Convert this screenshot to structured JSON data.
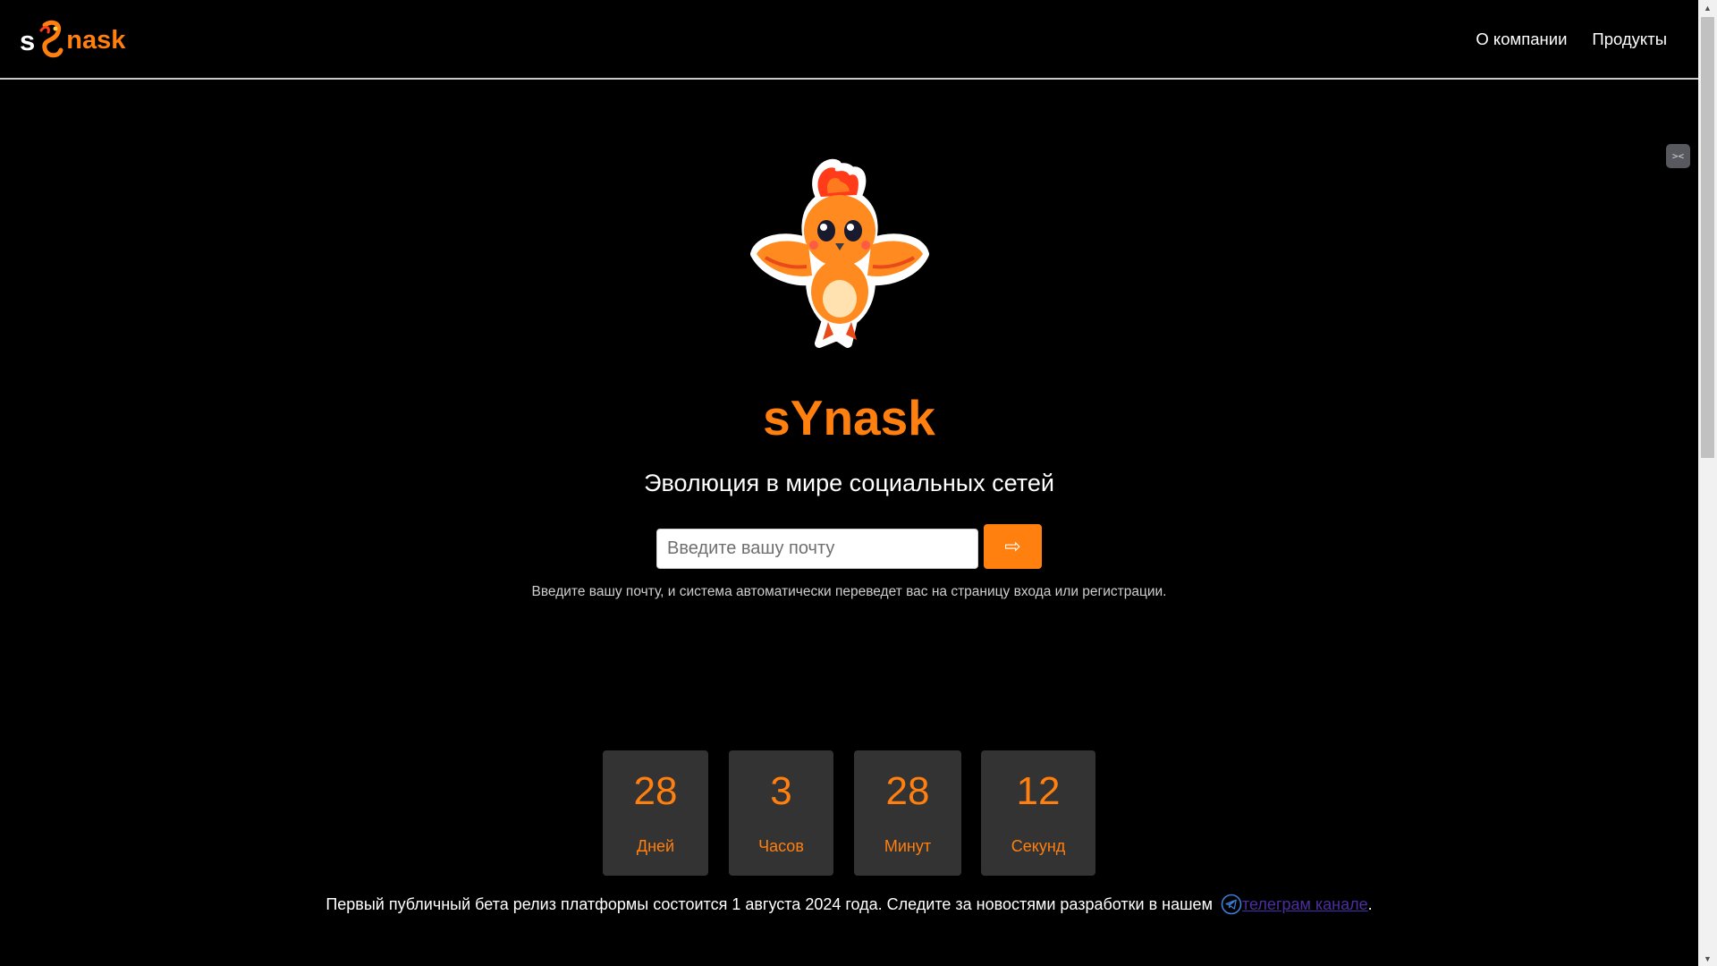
{
  "header": {
    "logo": {
      "prefix": "s",
      "suffix": "nask"
    },
    "nav": [
      {
        "label": "О компании"
      },
      {
        "label": "Продукты"
      }
    ]
  },
  "hero": {
    "title": "sYnask",
    "tagline": "Эволюция в мире социальных сетей",
    "email_placeholder": "Введите вашу почту",
    "submit_icon": "⇨",
    "hint": "Введите вашу почту, и система автоматически переведет вас на страницу входа или регистрации."
  },
  "countdown": [
    {
      "value": "28",
      "label": "Дней"
    },
    {
      "value": "3",
      "label": "Часов"
    },
    {
      "value": "28",
      "label": "Минут"
    },
    {
      "value": "12",
      "label": "Секунд"
    }
  ],
  "footer": {
    "text": "Первый публичный бета релиз платформы состоится 1 августа 2024 года. Следите за новостями разработки в нашем",
    "link_text": "телеграм канале",
    "trailing": "."
  },
  "icons": {
    "logo": "phoenix-logo-icon",
    "mascot": "phoenix-mascot-icon",
    "submit": "arrow-right-icon",
    "telegram": "telegram-icon",
    "extension": "extension-icon",
    "extension_glyph": "><"
  },
  "colors": {
    "accent": "#ff7f0f",
    "background": "#000000",
    "card": "#333333",
    "link": "#4b2ea3"
  }
}
